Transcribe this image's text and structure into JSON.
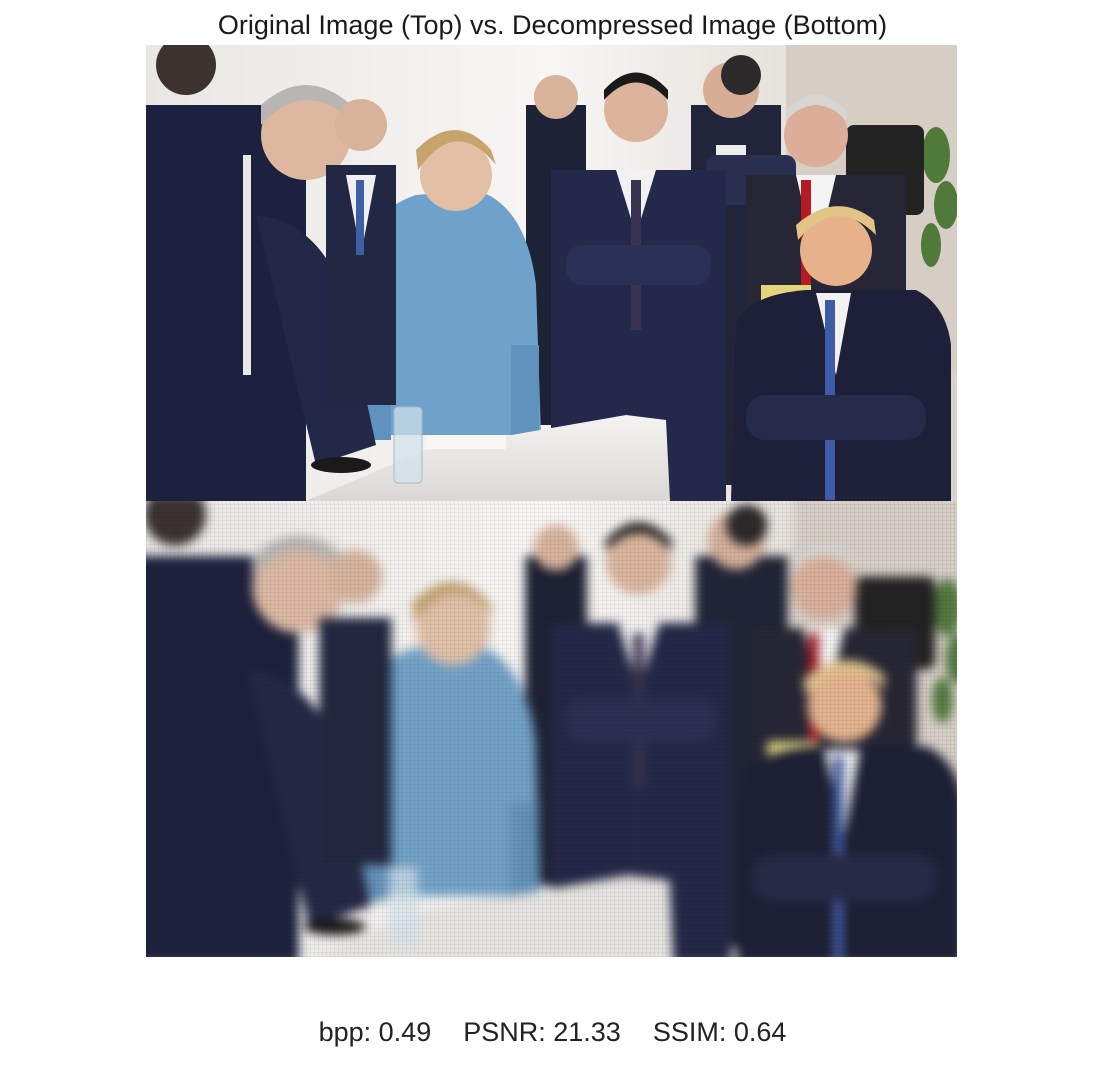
{
  "figure": {
    "title": "Original Image (Top) vs. Decompressed Image (Bottom)"
  },
  "panels": {
    "top_label": "original",
    "bottom_label": "decompressed"
  },
  "metrics": {
    "bpp_text": "bpp: 0.49",
    "psnr_text": "PSNR: 21.33",
    "ssim_text": "SSIM: 0.64",
    "bpp": 0.49,
    "psnr": 21.33,
    "ssim": 0.64
  },
  "colors": {
    "background": "#ffffff",
    "text": "#222222",
    "suit_navy": "#1f2444",
    "jacket_blue": "#6fa3cb",
    "table_white": "#ecebe8",
    "wall": "#f2f0ed"
  }
}
